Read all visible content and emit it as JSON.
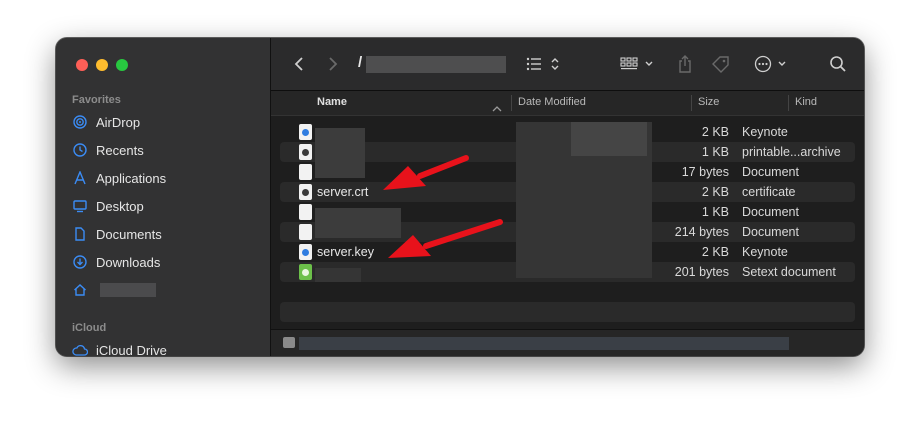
{
  "sidebar": {
    "favorites_label": "Favorites",
    "items": [
      {
        "label": "AirDrop",
        "icon": "airdrop-icon"
      },
      {
        "label": "Recents",
        "icon": "clock-icon"
      },
      {
        "label": "Applications",
        "icon": "applications-icon"
      },
      {
        "label": "Desktop",
        "icon": "desktop-icon"
      },
      {
        "label": "Documents",
        "icon": "document-icon"
      },
      {
        "label": "Downloads",
        "icon": "download-icon"
      },
      {
        "label": "",
        "icon": "home-icon"
      }
    ],
    "icloud_label": "iCloud",
    "icloud_items": [
      {
        "label": "iCloud Drive",
        "icon": "cloud-icon"
      }
    ]
  },
  "toolbar": {
    "path_title": "/",
    "icons": [
      "back-icon",
      "forward-icon",
      "list-view-icon",
      "grid-view-icon",
      "share-icon",
      "tag-icon",
      "more-icon",
      "search-icon"
    ]
  },
  "columns": {
    "name": "Name",
    "date_modified": "Date Modified",
    "size": "Size",
    "kind": "Kind"
  },
  "files": [
    {
      "name": "",
      "size": "2 KB",
      "kind": "Keynote",
      "icon": "keynote-file-icon"
    },
    {
      "name": "",
      "size": "1 KB",
      "kind": "printable...archive",
      "icon": "archive-file-icon"
    },
    {
      "name": "",
      "size": "17 bytes",
      "kind": "Document",
      "icon": "blank-file-icon"
    },
    {
      "name": "server.crt",
      "size": "2 KB",
      "kind": "certificate",
      "icon": "certificate-file-icon"
    },
    {
      "name": "",
      "size": "1 KB",
      "kind": "Document",
      "icon": "blank-file-icon"
    },
    {
      "name": "",
      "size": "214 bytes",
      "kind": "Document",
      "icon": "blank-file-icon"
    },
    {
      "name": "server.key",
      "size": "2 KB",
      "kind": "Keynote",
      "icon": "keynote-file-icon"
    },
    {
      "name": "",
      "size": "201 bytes",
      "kind": "Setext document",
      "icon": "setext-file-icon"
    }
  ],
  "colors": {
    "arrow": "#e8121b",
    "accent": "#3b8cf5",
    "traffic_red": "#fe5f57",
    "traffic_yellow": "#febc2e",
    "traffic_green": "#28c840"
  }
}
